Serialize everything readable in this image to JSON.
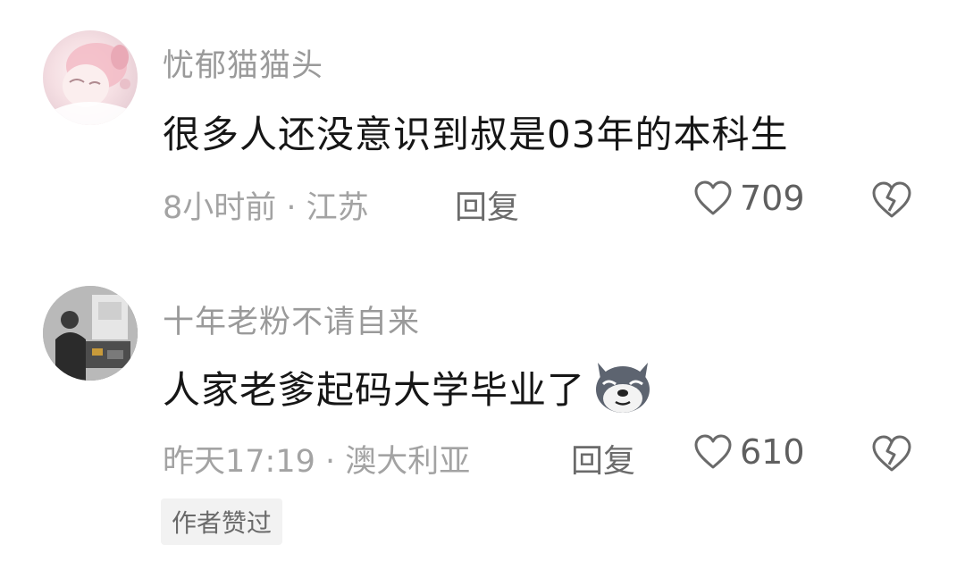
{
  "comments": [
    {
      "username": "忧郁猫猫头",
      "text": "很多人还没意识到叔是03年的本科生",
      "meta": "8小时前 · 江苏",
      "reply_label": "回复",
      "likes": "709",
      "avatar_icon": "anime-girl-avatar"
    },
    {
      "username": "十年老粉不请自来",
      "text": "人家老爹起码大学毕业了",
      "emoji_icon": "doge-wolf-emoji",
      "meta": "昨天17:19 · 澳大利亚",
      "reply_label": "回复",
      "likes": "610",
      "badge": "作者赞过",
      "avatar_icon": "photo-avatar"
    }
  ],
  "icons": {
    "like": "heart-outline-icon",
    "dislike": "broken-heart-icon"
  },
  "colors": {
    "username": "#9a9a9a",
    "content": "#161616",
    "meta": "#a3a3a3",
    "badge_bg": "#f2f2f2"
  }
}
